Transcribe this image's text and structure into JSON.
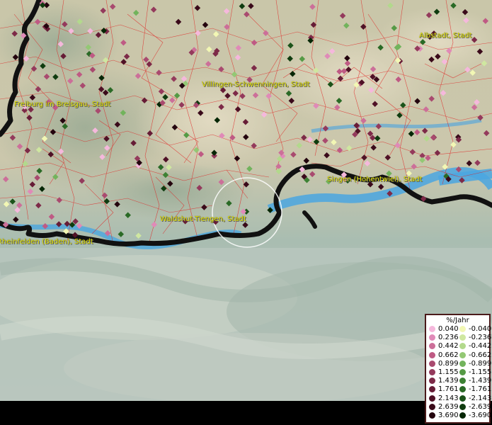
{
  "map": {
    "labels": [
      {
        "id": "albstadt",
        "text": "Albstadt, Stadt"
      },
      {
        "id": "villingen",
        "text": "Villingen-Schwenningen, Stadt"
      },
      {
        "id": "freiburg",
        "text": "Freiburg im Breisgau, Stadt"
      },
      {
        "id": "singen",
        "text": "Singen (Hohentwiel), Stadt"
      },
      {
        "id": "waldshut",
        "text": "Waldshut-Tiengen, Stadt"
      },
      {
        "id": "rheinfelden",
        "text": "Rheinfelden (Baden), Stadt"
      }
    ]
  },
  "legend": {
    "title": "%/Jahr",
    "positive": [
      {
        "value": "0.040",
        "color": "#f5b8dc"
      },
      {
        "value": "0.236",
        "color": "#e08ab8"
      },
      {
        "value": "0.442",
        "color": "#cc6f99"
      },
      {
        "value": "0.662",
        "color": "#bf5a84"
      },
      {
        "value": "0.899",
        "color": "#a94a6f"
      },
      {
        "value": "1.155",
        "color": "#943a5c"
      },
      {
        "value": "1.439",
        "color": "#7d2a48"
      },
      {
        "value": "1.761",
        "color": "#661c36"
      },
      {
        "value": "2.143",
        "color": "#4f1126"
      },
      {
        "value": "2.639",
        "color": "#3a0a1a"
      },
      {
        "value": "3.690",
        "color": "#24040e"
      }
    ],
    "negative": [
      {
        "value": "-0.040",
        "color": "#f2f7b4"
      },
      {
        "value": "-0.236",
        "color": "#cfe7a0"
      },
      {
        "value": "-0.442",
        "color": "#b2d98c"
      },
      {
        "value": "-0.662",
        "color": "#93c874"
      },
      {
        "value": "-0.899",
        "color": "#72b35c"
      },
      {
        "value": "-1.155",
        "color": "#559a45"
      },
      {
        "value": "-1.439",
        "color": "#3d8234"
      },
      {
        "value": "-1.761",
        "color": "#2a6a26"
      },
      {
        "value": "-2.143",
        "color": "#1b531a"
      },
      {
        "value": "-2.639",
        "color": "#0f3c0f"
      },
      {
        "value": "-3.690",
        "color": "#052605"
      }
    ]
  }
}
